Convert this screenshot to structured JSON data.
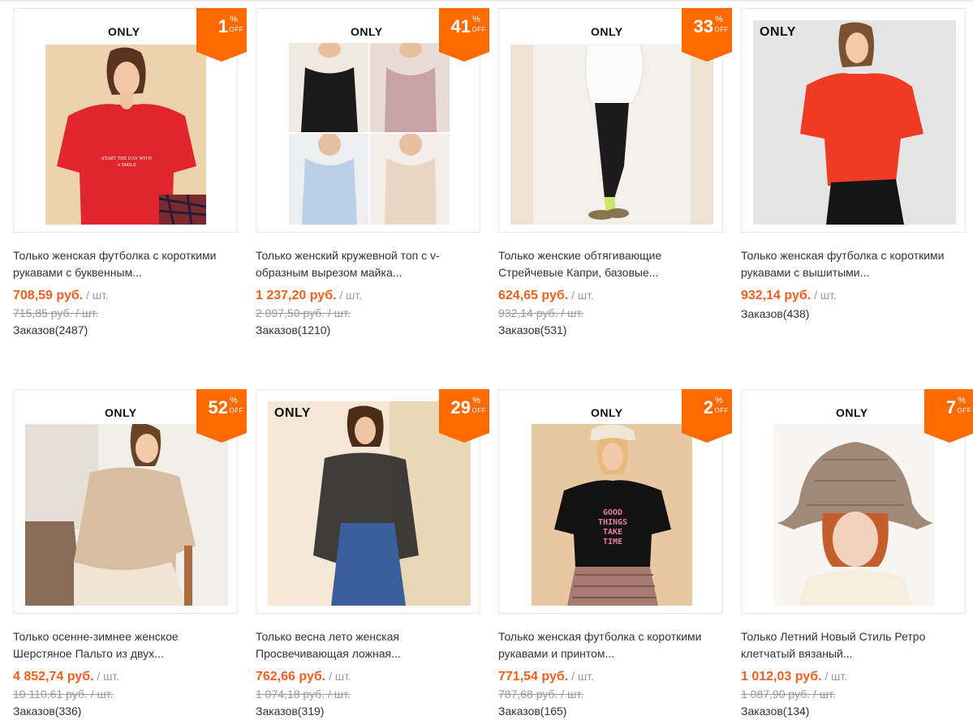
{
  "brand_label": "ONLY",
  "badge_percent": "%",
  "badge_off": "OFF",
  "accent_color": "#ff6a00",
  "products": [
    {
      "discount": "1",
      "title": "Только женская футболка с короткими рукавами с буквенным...",
      "price": "708,59 руб.",
      "unit": "/ шт.",
      "old_price": "715,85 руб. / шт.",
      "orders": "Заказов(2487)"
    },
    {
      "discount": "41",
      "title": "Только женский кружевной топ с v-образным вырезом майка...",
      "price": "1 237,20 руб.",
      "unit": "/ шт.",
      "old_price": "2 097,50 руб. / шт.",
      "orders": "Заказов(1210)"
    },
    {
      "discount": "33",
      "title": "Только женские обтягивающие Стрейчевые Капри, базовые...",
      "price": "624,65 руб.",
      "unit": "/ шт.",
      "old_price": "932,14 руб. / шт.",
      "orders": "Заказов(531)"
    },
    {
      "discount": "",
      "title": "Только женская футболка с короткими рукавами с вышитыми...",
      "price": "932,14 руб.",
      "unit": "/ шт.",
      "old_price": "",
      "orders": "Заказов(438)"
    },
    {
      "discount": "52",
      "title": "Только осенне-зимнее женское Шерстяное Пальто из двух...",
      "price": "4 852,74 руб.",
      "unit": "/ шт.",
      "old_price": "10 110,61 руб. / шт.",
      "orders": "Заказов(336)"
    },
    {
      "discount": "29",
      "title": "Только весна лето женская Просвечивающая ложная...",
      "price": "762,66 руб.",
      "unit": "/ шт.",
      "old_price": "1 074,18 руб. / шт.",
      "orders": "Заказов(319)"
    },
    {
      "discount": "2",
      "title": "Только женская футболка с короткими рукавами и принтом...",
      "price": "771,54 руб.",
      "unit": "/ шт.",
      "old_price": "787,68 руб. / шт.",
      "orders": "Заказов(165)"
    },
    {
      "discount": "7",
      "title": "Только Летний Новый Стиль Ретро клетчатый вязаный...",
      "price": "1 012,03 руб.",
      "unit": "/ шт.",
      "old_price": "1 087,90 руб. / шт.",
      "orders": "Заказов(134)"
    }
  ],
  "shirt_text": {
    "p1": "START THE DAY WITH A SMILE",
    "p7": "GOOD THINGS TAKE TIME"
  }
}
